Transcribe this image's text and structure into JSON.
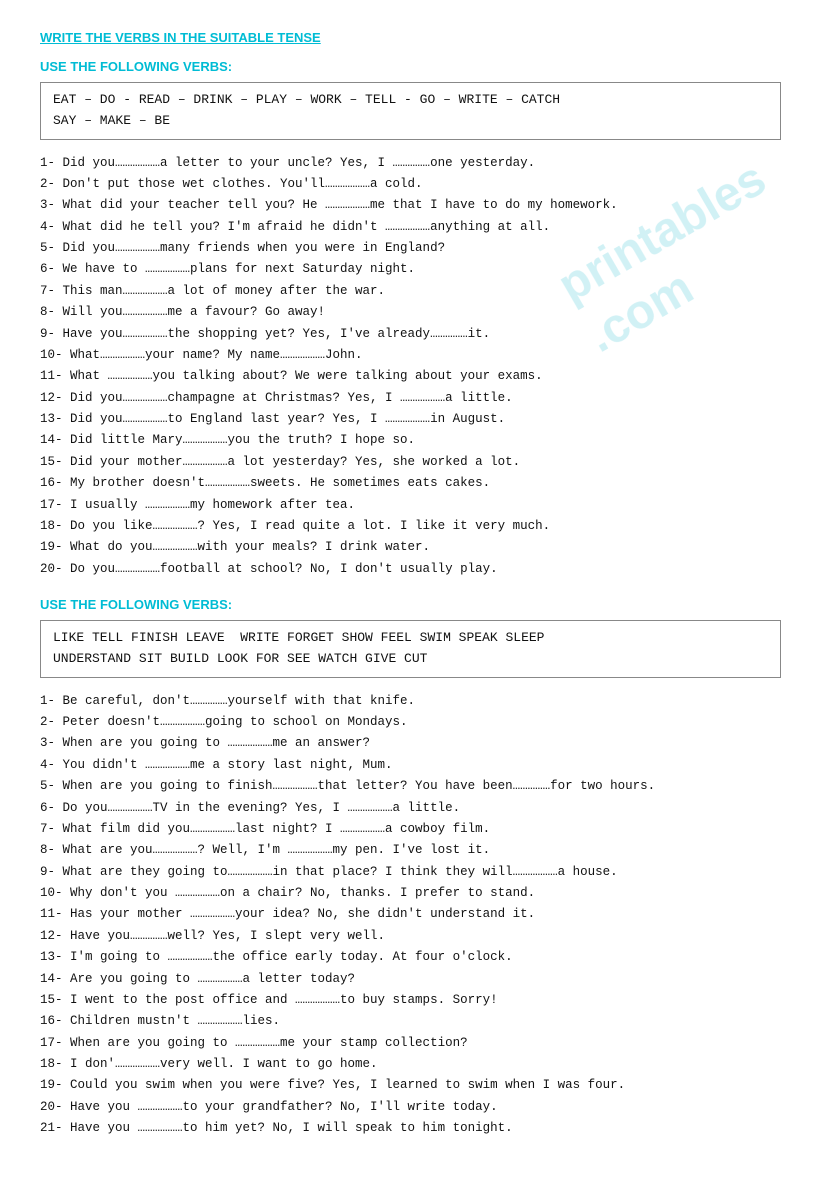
{
  "watermark": "printables\n.com",
  "main_title": "WRITE THE VERBS IN THE SUITABLE TENSE",
  "section1_title": "USE THE FOLLOWING VERBS:",
  "section1_verbs": "EAT – DO - READ – DRINK – PLAY – WORK – TELL -  GO – WRITE – CATCH\nSAY – MAKE – BE",
  "section1_items": [
    "1-   Did you………………a letter to your uncle? Yes, I ……………one yesterday.",
    "2-   Don't put those wet clothes. You'll………………a cold.",
    "3-   What did your teacher tell you? He ………………me that I have to do my homework.",
    "4-   What did he tell you? I'm afraid he didn't ………………anything at all.",
    "5-   Did you………………many friends when you were in England?",
    "6-   We have to ………………plans for next Saturday night.",
    "7-   This man………………a lot of money after the war.",
    "8-   Will you………………me a favour? Go away!",
    "9-   Have you………………the shopping yet? Yes, I've already……………it.",
    "10- What………………your name? My name………………John.",
    "11- What ………………you talking about? We were talking about your exams.",
    "12- Did you………………champagne at Christmas? Yes, I ………………a little.",
    "13- Did you………………to England last year? Yes, I ………………in August.",
    "14- Did little Mary………………you the truth? I hope so.",
    "15- Did your mother………………a lot yesterday? Yes, she worked a lot.",
    "16- My brother doesn't………………sweets. He sometimes eats cakes.",
    "17- I usually ………………my homework after tea.",
    "18- Do you like………………? Yes, I read quite a lot. I like it very much.",
    "19- What do you………………with your meals? I drink water.",
    "20- Do you………………football at school? No, I don't usually play."
  ],
  "section2_title": "USE THE FOLLOWING VERBS:",
  "section2_verbs": "LIKE TELL FINISH LEAVE  WRITE FORGET SHOW FEEL SWIM SPEAK SLEEP\nUNDERSTAND SIT BUILD LOOK FOR SEE WATCH GIVE CUT",
  "section2_items": [
    "1-   Be careful, don't……………yourself with that knife.",
    "2-   Peter doesn't………………going to school on Mondays.",
    "3-   When are you going to ………………me an answer?",
    "4-   You didn't ………………me a story last night, Mum.",
    "5-   When are you going to finish………………that letter? You have been……………for two hours.",
    "6-   Do you………………TV in the evening? Yes, I ………………a little.",
    "7-   What film did you………………last night? I ………………a cowboy film.",
    "8-   What are you………………? Well, I'm ………………my pen. I've lost it.",
    "9-   What are they going to………………in that place? I think they will………………a house.",
    "10- Why don't you ………………on a chair? No, thanks. I prefer to stand.",
    "11- Has your mother ………………your idea? No, she didn't understand it.",
    "12- Have you……………well? Yes, I slept very well.",
    "13- I'm going to ………………the office early today. At four o'clock.",
    "14- Are you going to ………………a letter today?",
    "15- I went to the post office and ………………to buy stamps. Sorry!",
    "16- Children mustn't ………………lies.",
    "17- When are you going to ………………me your stamp collection?",
    "18- I don'………………very well. I want to go home.",
    "19- Could you swim when you were five? Yes, I learned to swim when I was four.",
    "20- Have you ………………to your grandfather? No, I'll write today.",
    "21- Have you ………………to him yet? No, I will speak to him tonight."
  ]
}
